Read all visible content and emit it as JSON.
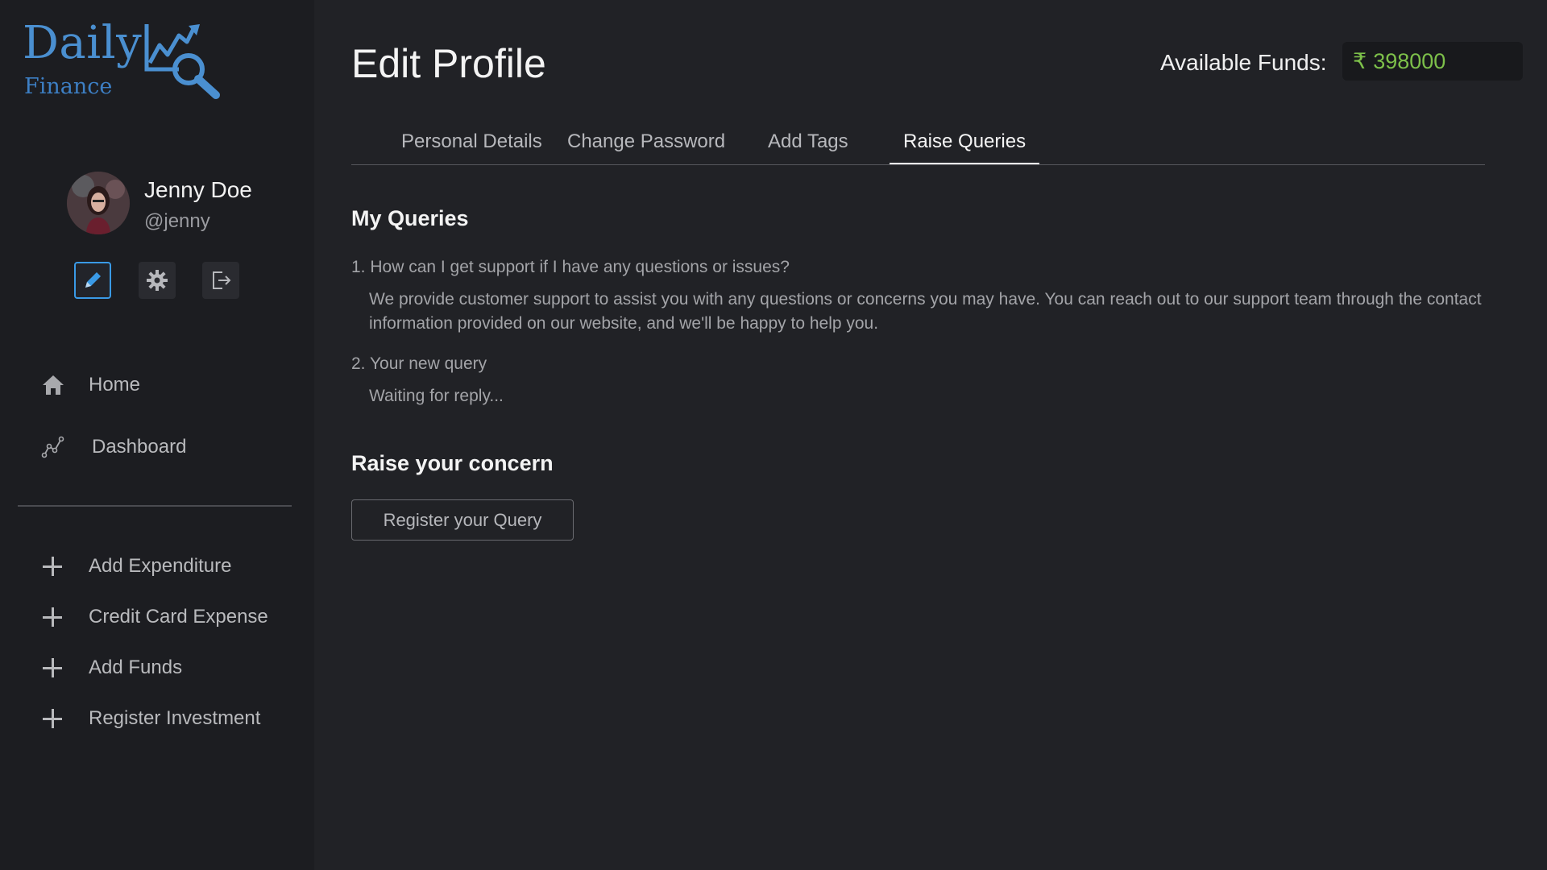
{
  "brand": {
    "name_top": "Daily",
    "name_bottom": "Finance",
    "primary_color": "#4a8fd0"
  },
  "user": {
    "name": "Jenny Doe",
    "handle": "@jenny"
  },
  "profile_actions": [
    {
      "icon": "pencil-icon",
      "label": "edit",
      "active": true
    },
    {
      "icon": "gear-icon",
      "label": "settings"
    },
    {
      "icon": "logout-icon",
      "label": "logout"
    }
  ],
  "nav": {
    "home_label": "Home",
    "dashboard_label": "Dashboard"
  },
  "actions": {
    "add_expenditure": "Add Expenditure",
    "credit_card_expense": "Credit Card Expense",
    "add_funds": "Add Funds",
    "register_investment": "Register Investment"
  },
  "header": {
    "title": "Edit Profile",
    "funds_label": "Available Funds:",
    "funds_symbol": "₹",
    "funds_value": "398000",
    "funds_color": "#7dc04a"
  },
  "tabs": [
    {
      "label": "Personal Details"
    },
    {
      "label": "Change Password"
    },
    {
      "label": "Add Tags"
    },
    {
      "label": "Raise Queries",
      "active": true
    }
  ],
  "queries": {
    "title": "My Queries",
    "items": [
      {
        "question": "1. How can I get support if I have any questions or issues?",
        "answer": "We provide customer support to assist you with any questions or concerns you may have. You can reach out to our support team through the contact information provided on our website, and we'll be happy to help you."
      },
      {
        "question": "2. Your new query",
        "answer": "Waiting for reply..."
      }
    ]
  },
  "concern": {
    "title": "Raise your concern",
    "button_label": "Register your Query"
  }
}
